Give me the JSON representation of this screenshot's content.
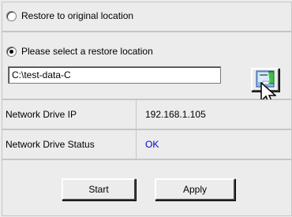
{
  "restore": {
    "option_original": "Restore to original location",
    "option_select": "Please select a restore location",
    "selected": "select",
    "path_value": "C:\\test-data-C"
  },
  "browse": {
    "icon": "folder-browse-icon"
  },
  "network": {
    "ip_label": "Network Drive IP",
    "ip_value": "192.168.1.105",
    "status_label": "Network Drive Status",
    "status_value": "OK",
    "status_color": "#0000cc"
  },
  "actions": {
    "start_label": "Start",
    "apply_label": "Apply"
  }
}
